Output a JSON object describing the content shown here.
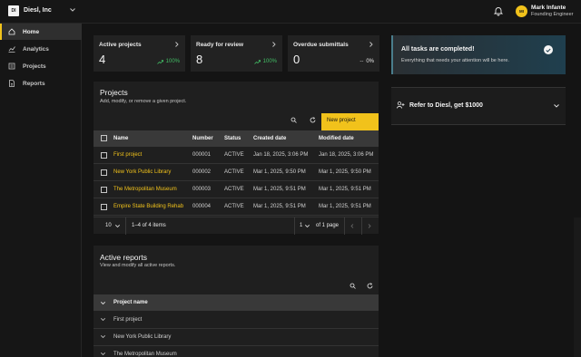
{
  "org": {
    "logo_text": "DI",
    "name": "Diesl, Inc"
  },
  "user": {
    "initials": "MI",
    "name": "Mark Infante",
    "role": "Founding Engineer"
  },
  "nav": [
    {
      "label": "Home",
      "icon": "home-icon",
      "active": true
    },
    {
      "label": "Analytics",
      "icon": "analytics-icon"
    },
    {
      "label": "Projects",
      "icon": "projects-icon"
    },
    {
      "label": "Reports",
      "icon": "reports-icon"
    }
  ],
  "cards": [
    {
      "title": "Active projects",
      "value": "4",
      "trend": "100%",
      "trend_icon": "trend-up-icon"
    },
    {
      "title": "Ready for review",
      "value": "8",
      "trend": "100%",
      "trend_icon": "trend-up-icon"
    },
    {
      "title": "Overdue submittals",
      "value": "0",
      "trend": "0%",
      "trend_prefix": "--"
    }
  ],
  "projects": {
    "title": "Projects",
    "subtitle": "Add, modify, or remove a given project.",
    "new_button": "New project",
    "columns": [
      "Name",
      "Number",
      "Status",
      "Created date",
      "Modified date"
    ],
    "rows": [
      [
        "First project",
        "000001",
        "ACTIVE",
        "Jan 18, 2025, 3:06 PM",
        "Jan 18, 2025, 3:06 PM"
      ],
      [
        "New York Public Library",
        "000002",
        "ACTIVE",
        "Mar 1, 2025, 9:50 PM",
        "Mar 1, 2025, 9:50 PM"
      ],
      [
        "The Metropolitan Museum",
        "000003",
        "ACTIVE",
        "Mar 1, 2025, 9:51 PM",
        "Mar 1, 2025, 9:51 PM"
      ],
      [
        "Empire State Building Rehab",
        "000004",
        "ACTIVE",
        "Mar 1, 2025, 9:51 PM",
        "Mar 1, 2025, 9:51 PM"
      ]
    ],
    "pagination": {
      "page_size": "10",
      "range": "1–4 of 4 items",
      "page": "1",
      "of_pages": "of 1 page"
    }
  },
  "alert": {
    "title": "All tasks are completed!",
    "body": "Everything that needs your attention will be here."
  },
  "refer": {
    "label": "Refer to Diesl, get $1000"
  },
  "reports": {
    "title": "Active reports",
    "subtitle": "View and modify all active reports.",
    "column": "Project name",
    "rows": [
      "First project",
      "New York Public Library",
      "The Metropolitan Museum"
    ]
  },
  "colors": {
    "accent": "#f1c21b",
    "success": "#42be65",
    "background": "#141414",
    "panel": "#1f1f1f"
  }
}
